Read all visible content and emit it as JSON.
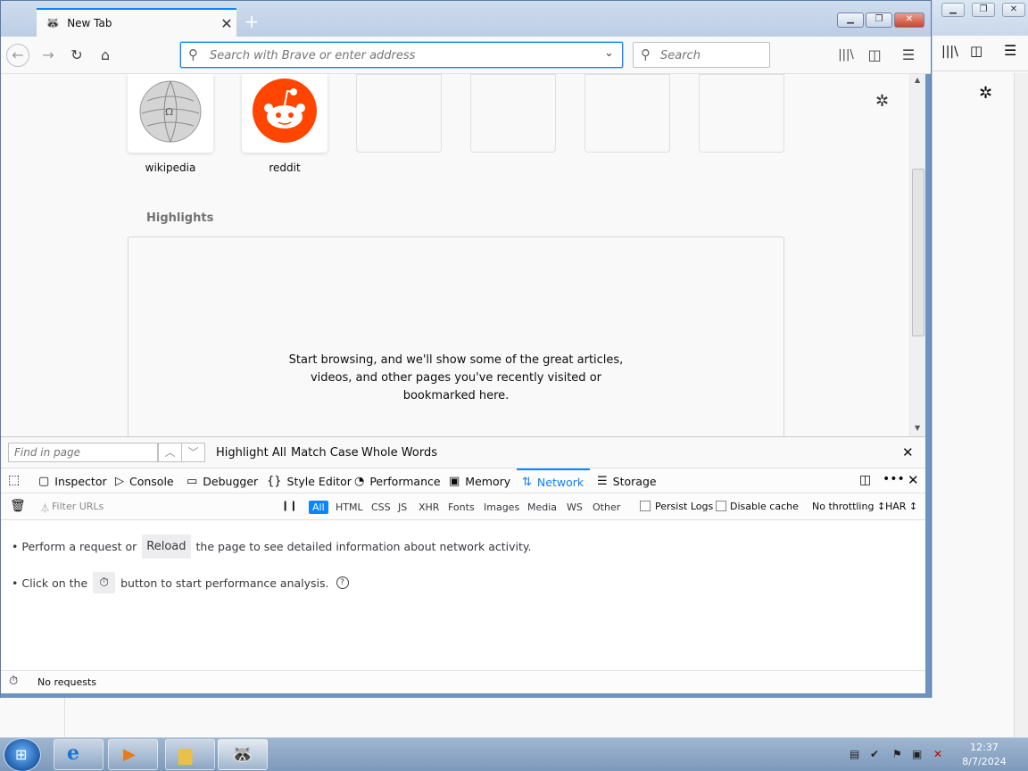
{
  "browser": {
    "tab_title": "New Tab",
    "url_placeholder": "Search with Brave or enter address",
    "search_placeholder": "Search",
    "accent_color": "#0a84ff"
  },
  "newtab": {
    "top_sites": [
      {
        "label": "wikipedia",
        "icon": "wikipedia-globe-icon"
      },
      {
        "label": "reddit",
        "icon": "reddit-alien-icon"
      },
      {
        "label": ""
      },
      {
        "label": ""
      },
      {
        "label": ""
      },
      {
        "label": ""
      }
    ],
    "highlights_title": "Highlights",
    "highlights_empty": "Start browsing, and we'll show some of the great articles,\nvideos, and other pages you've recently visited or\nbookmarked here."
  },
  "findbar": {
    "placeholder": "Find in page",
    "highlight_all": "Highlight All",
    "match_case": "Match Case",
    "whole_words": "Whole Words"
  },
  "devtools": {
    "tabs": [
      "Inspector",
      "Console",
      "Debugger",
      "Style Editor",
      "Performance",
      "Memory",
      "Network",
      "Storage"
    ],
    "selected_tab": "Network",
    "filter_placeholder": "Filter URLs",
    "filter_types": [
      "All",
      "HTML",
      "CSS",
      "JS",
      "XHR",
      "Fonts",
      "Images",
      "Media",
      "WS",
      "Other"
    ],
    "persist_logs": "Persist Logs",
    "disable_cache": "Disable cache",
    "throttling": "No throttling ↕",
    "har": "HAR ↕",
    "msg1_before": "• Perform a request or",
    "reload_label": "Reload",
    "msg1_after": "the page to see detailed information about network activity.",
    "msg2_before": "• Click on the",
    "msg2_after": "button to start performance analysis.",
    "status": "No requests"
  },
  "taskbar": {
    "time": "12:37",
    "date": "8/7/2024"
  }
}
